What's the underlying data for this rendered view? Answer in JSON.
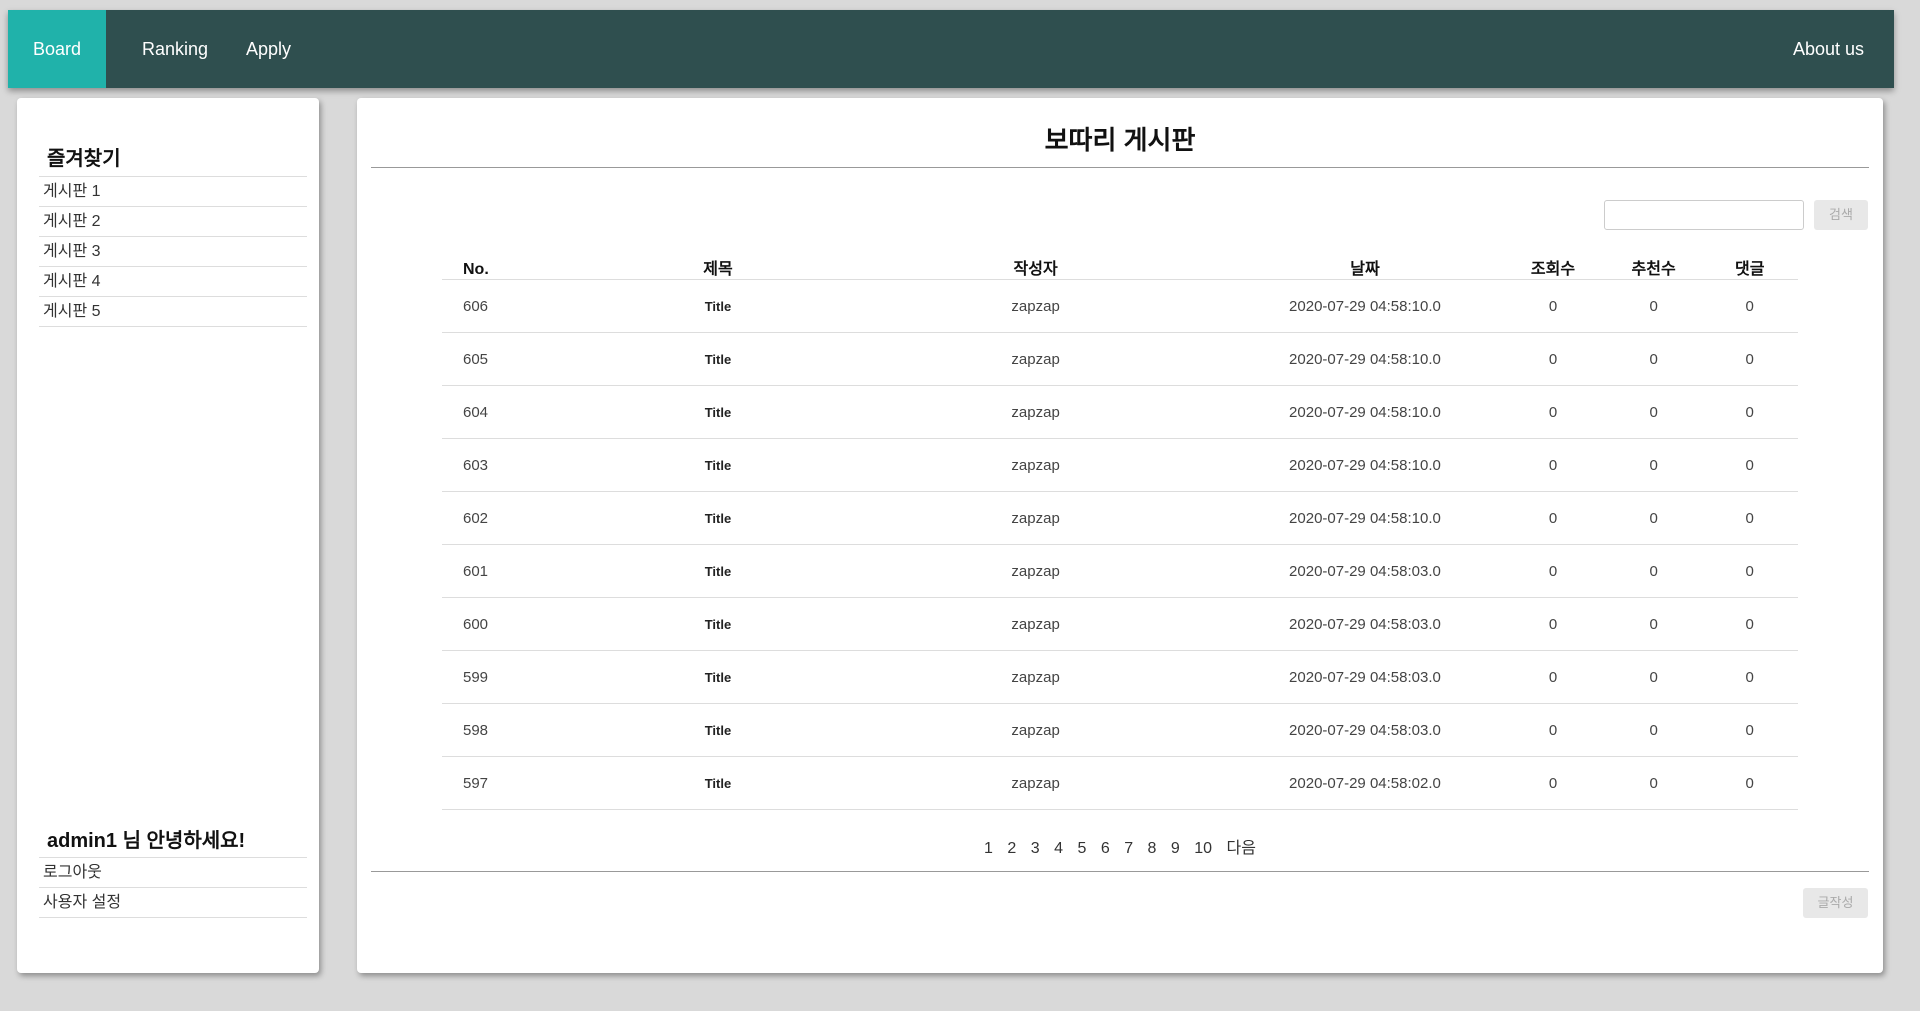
{
  "nav": {
    "board": "Board",
    "ranking": "Ranking",
    "apply": "Apply",
    "about": "About us"
  },
  "sidebar": {
    "favorites_heading": "즐겨찾기",
    "favorites": [
      "게시판 1",
      "게시판 2",
      "게시판 3",
      "게시판 4",
      "게시판 5"
    ],
    "greeting": "admin1 님 안녕하세요!",
    "user_menu": [
      "로그아웃",
      "사용자 설정"
    ]
  },
  "main": {
    "title": "보따리 게시판",
    "search_button": "검색",
    "write_button": "글작성",
    "columns": [
      "No.",
      "제목",
      "작성자",
      "날짜",
      "조회수",
      "추천수",
      "댓글"
    ],
    "rows": [
      [
        "606",
        "Title",
        "zapzap",
        "2020-07-29 04:58:10.0",
        "0",
        "0",
        "0"
      ],
      [
        "605",
        "Title",
        "zapzap",
        "2020-07-29 04:58:10.0",
        "0",
        "0",
        "0"
      ],
      [
        "604",
        "Title",
        "zapzap",
        "2020-07-29 04:58:10.0",
        "0",
        "0",
        "0"
      ],
      [
        "603",
        "Title",
        "zapzap",
        "2020-07-29 04:58:10.0",
        "0",
        "0",
        "0"
      ],
      [
        "602",
        "Title",
        "zapzap",
        "2020-07-29 04:58:10.0",
        "0",
        "0",
        "0"
      ],
      [
        "601",
        "Title",
        "zapzap",
        "2020-07-29 04:58:03.0",
        "0",
        "0",
        "0"
      ],
      [
        "600",
        "Title",
        "zapzap",
        "2020-07-29 04:58:03.0",
        "0",
        "0",
        "0"
      ],
      [
        "599",
        "Title",
        "zapzap",
        "2020-07-29 04:58:03.0",
        "0",
        "0",
        "0"
      ],
      [
        "598",
        "Title",
        "zapzap",
        "2020-07-29 04:58:03.0",
        "0",
        "0",
        "0"
      ],
      [
        "597",
        "Title",
        "zapzap",
        "2020-07-29 04:58:02.0",
        "0",
        "0",
        "0"
      ]
    ],
    "pages": [
      "1",
      "2",
      "3",
      "4",
      "5",
      "6",
      "7",
      "8",
      "9",
      "10"
    ],
    "next_label": "다음"
  },
  "colors": {
    "nav_bg": "#2f4f4f",
    "nav_active": "#20b2aa"
  }
}
